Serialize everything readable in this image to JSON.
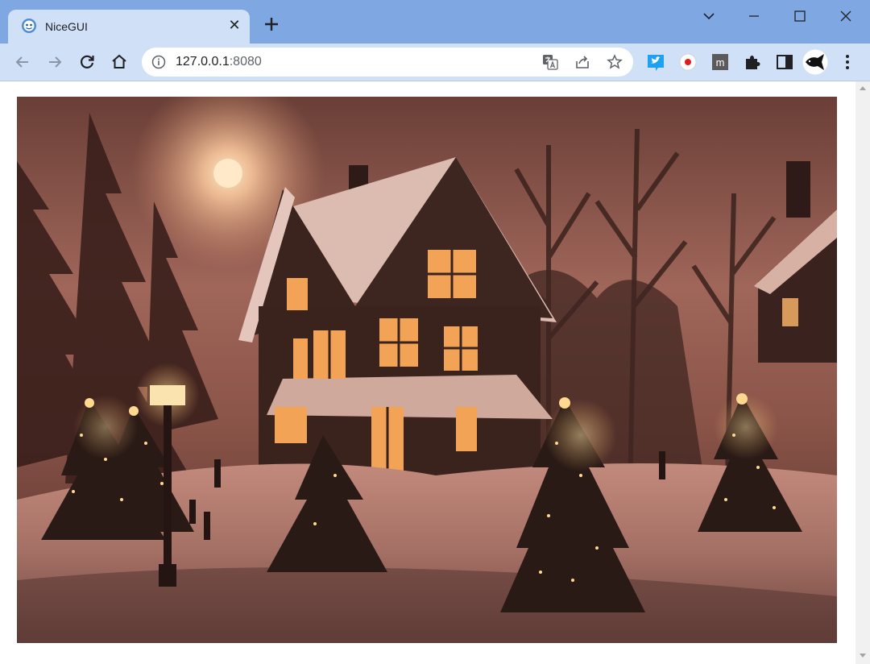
{
  "browser": {
    "tab": {
      "title": "NiceGUI",
      "icon": "nicegui-logo-icon"
    },
    "address_bar": {
      "host": "127.0.0.1",
      "port": ":8080"
    },
    "nav_icons": [
      "back-arrow-icon",
      "forward-arrow-icon",
      "reload-icon",
      "home-icon"
    ],
    "extension_icons": [
      "twitter-extension-icon",
      "red-dot-extension-icon",
      "m-extension-icon",
      "puzzle-extensions-icon",
      "side-panel-icon",
      "fish-avatar-icon"
    ],
    "colors": {
      "titlebar": "#7fa8e3",
      "toolbar": "#cfe0f7",
      "omnibox": "#ffffff"
    }
  },
  "page": {
    "image": {
      "subject": "snowy-house-with-christmas-trees-at-night"
    }
  }
}
